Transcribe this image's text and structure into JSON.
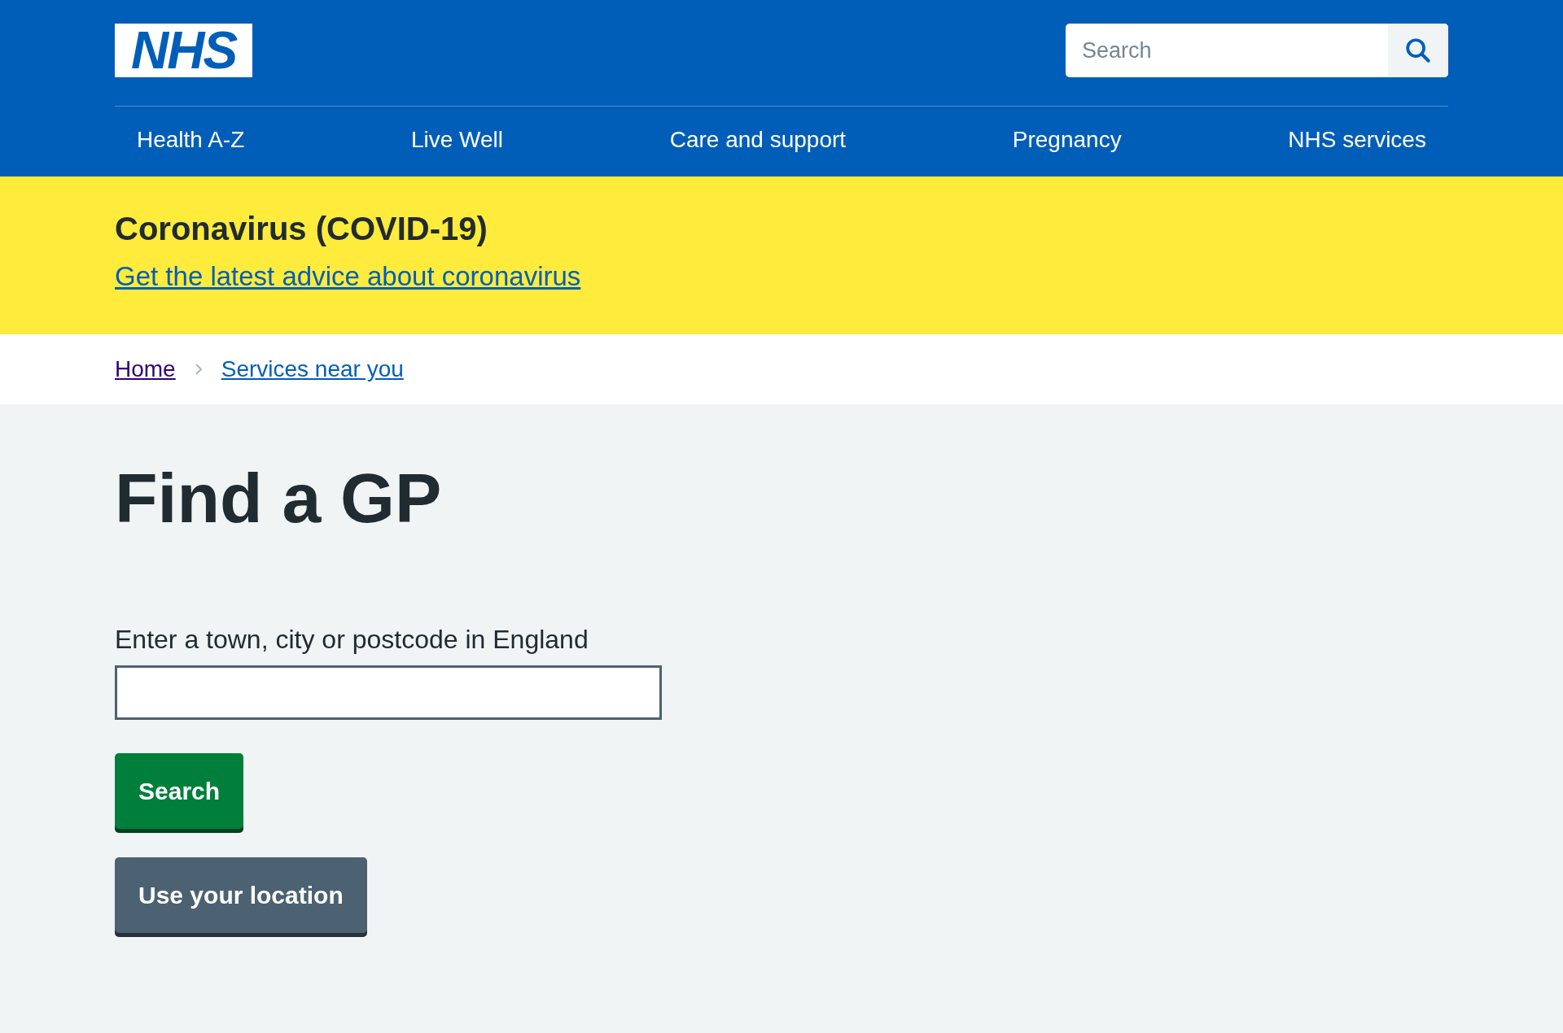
{
  "header": {
    "logo": "NHS",
    "search": {
      "placeholder": "Search"
    }
  },
  "nav": [
    {
      "label": "Health A-Z"
    },
    {
      "label": "Live Well"
    },
    {
      "label": "Care and support"
    },
    {
      "label": "Pregnancy"
    },
    {
      "label": "NHS services"
    }
  ],
  "alert": {
    "title": "Coronavirus (COVID-19)",
    "link": "Get the latest advice about coronavirus"
  },
  "breadcrumb": [
    {
      "label": "Home",
      "visited": true
    },
    {
      "label": "Services near you",
      "visited": false
    }
  ],
  "main": {
    "heading": "Find a GP",
    "field_label": "Enter a town, city or postcode in England",
    "buttons": [
      {
        "label": "Search",
        "kind": "primary"
      },
      {
        "label": "Use your location",
        "kind": "secondary"
      }
    ]
  }
}
